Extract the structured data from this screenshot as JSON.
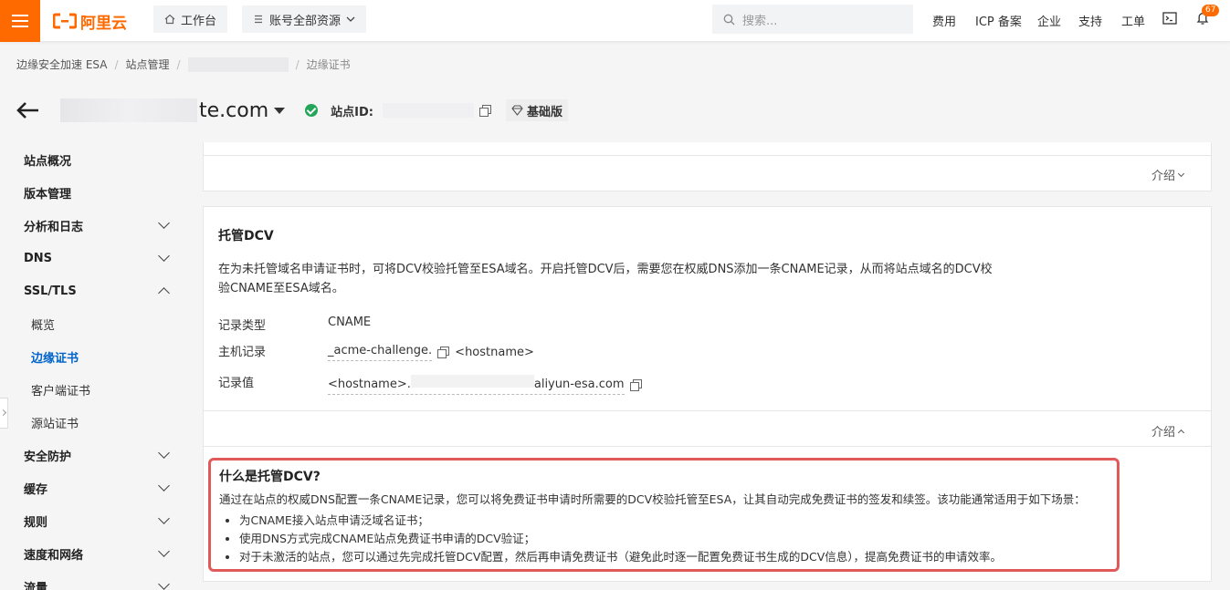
{
  "topbar": {
    "brand": "阿里云",
    "workbench": "工作台",
    "resources": "账号全部资源",
    "search_placeholder": "搜索...",
    "links": [
      "费用",
      "ICP 备案",
      "企业",
      "支持",
      "工单"
    ],
    "notification_count": "67",
    "accent": "#ff6a00"
  },
  "breadcrumb": {
    "items": [
      "边缘安全加速 ESA",
      "站点管理"
    ],
    "current": "边缘证书"
  },
  "header": {
    "site_suffix": "te.com",
    "site_id_label": "站点ID:",
    "plan": "基础版"
  },
  "sidebar": {
    "items": [
      {
        "label": "站点概况"
      },
      {
        "label": "版本管理"
      },
      {
        "label": "分析和日志"
      },
      {
        "label": "DNS"
      },
      {
        "label": "SSL/TLS"
      },
      {
        "label": "概览"
      },
      {
        "label": "边缘证书"
      },
      {
        "label": "客户端证书"
      },
      {
        "label": "源站证书"
      },
      {
        "label": "安全防护"
      },
      {
        "label": "缓存"
      },
      {
        "label": "规则"
      },
      {
        "label": "速度和网络"
      },
      {
        "label": "流量"
      }
    ],
    "active_color": "#0064c8"
  },
  "card1": {
    "intro_toggle": "介绍"
  },
  "dcv": {
    "title": "托管DCV",
    "description": "在为未托管域名申请证书时，可将DCV校验托管至ESA域名。开启托管DCV后，需要您在权威DNS添加一条CNAME记录，从而将站点域名的DCV校验CNAME至ESA域名。",
    "record_type_label": "记录类型",
    "record_type_value": "CNAME",
    "host_label": "主机记录",
    "host_value": "_acme-challenge.",
    "host_suffix": "<hostname>",
    "record_value_label": "记录值",
    "record_value_prefix": "<hostname>.",
    "record_value_suffix": "aliyun-esa.com",
    "intro_toggle": "介绍"
  },
  "callout": {
    "title": "什么是托管DCV?",
    "description": "通过在站点的权威DNS配置一条CNAME记录，您可以将免费证书申请时所需要的DCV校验托管至ESA，让其自动完成免费证书的签发和续签。该功能通常适用于如下场景：",
    "bullets": [
      "为CNAME接入站点申请泛域名证书；",
      "使用DNS方式完成CNAME站点免费证书申请的DCV验证；",
      "对于未激活的站点，您可以通过先完成托管DCV配置，然后再申请免费证书（避免此时逐一配置免费证书生成的DCV信息），提高免费证书的申请效率。"
    ],
    "border_color": "#e05a5a"
  }
}
